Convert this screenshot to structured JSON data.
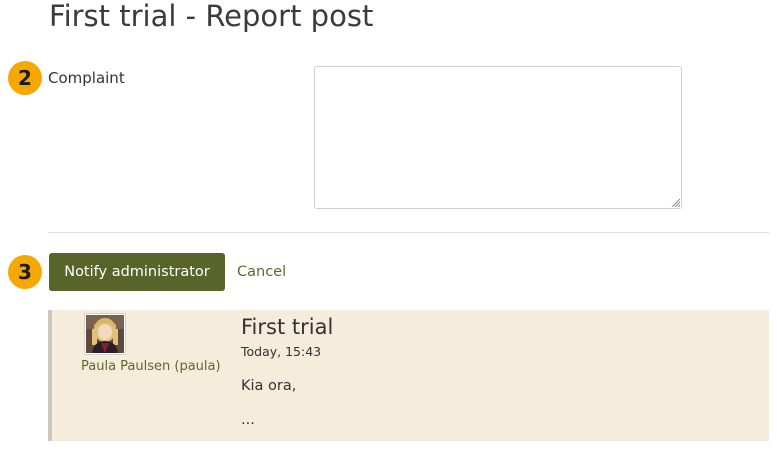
{
  "page": {
    "title": "First trial - Report post"
  },
  "steps": {
    "complaint_step": "2",
    "submit_step": "3"
  },
  "form": {
    "complaint_label": "Complaint",
    "complaint_value": ""
  },
  "actions": {
    "notify_label": "Notify administrator",
    "cancel_label": "Cancel"
  },
  "post": {
    "author": "Paula Paulsen (paula)",
    "title": "First trial",
    "time": "Today, 15:43",
    "body_line1": "Kia ora,",
    "body_line2": "..."
  },
  "icons": {
    "avatar": "user-avatar-image",
    "resize": "resize-grip-icon"
  },
  "colors": {
    "badge": "#f5a800",
    "primary_button": "#59642b",
    "link": "#5b6a2c",
    "post_background": "#f5ecdc"
  }
}
